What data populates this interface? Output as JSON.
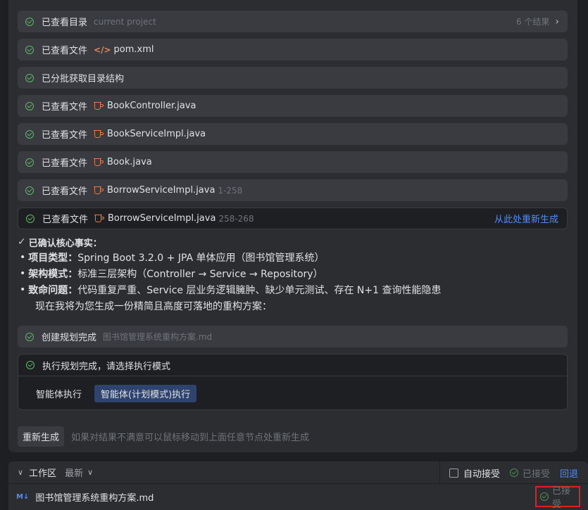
{
  "steps": [
    {
      "label": "已查看目录",
      "meta": "current project",
      "count": "6 个结果"
    },
    {
      "label": "已查看文件",
      "file": "pom.xml"
    },
    {
      "label": "已分批获取目录结构"
    },
    {
      "label": "已查看文件",
      "file": "BookController.java"
    },
    {
      "label": "已查看文件",
      "file": "BookServiceImpl.java"
    },
    {
      "label": "已查看文件",
      "file": "Book.java"
    },
    {
      "label": "已查看文件",
      "file": "BorrowServiceImpl.java",
      "range": "1-258"
    },
    {
      "label": "已查看文件",
      "file": "BorrowServiceImpl.java",
      "range": "258-268",
      "action": "从此处重新生成"
    }
  ],
  "facts": {
    "title": "已确认核心事实：",
    "items": [
      {
        "key": "项目类型：",
        "text": "Spring Boot 3.2.0 + JPA 单体应用（图书馆管理系统）"
      },
      {
        "key": "架构模式：",
        "text": "标准三层架构（Controller → Service → Repository）"
      },
      {
        "key": "致命问题：",
        "text": "代码重复严重、Service 层业务逻辑臃肿、缺少单元测试、存在 N+1 查询性能隐患"
      }
    ],
    "closing": "现在我将为您生成一份精简且高度可落地的重构方案："
  },
  "plan": {
    "label": "创建规划完成",
    "file": "图书馆管理系统重构方案.md"
  },
  "exec": {
    "label": "执行规划完成，请选择执行模式",
    "option_plain": "智能体执行",
    "option_selected": "智能体(计划模式)执行"
  },
  "regen": {
    "button": "重新生成",
    "hint": "如果对结果不满意可以鼠标移动到上面任意节点处重新生成"
  },
  "workspace": {
    "title": "工作区",
    "filter": "最新",
    "auto_accept": "自动接受",
    "accepted": "已接受",
    "rollback": "回退",
    "file_icon": "M↓",
    "file": "图书馆管理系统重构方案.md",
    "file_status": "已接受"
  }
}
